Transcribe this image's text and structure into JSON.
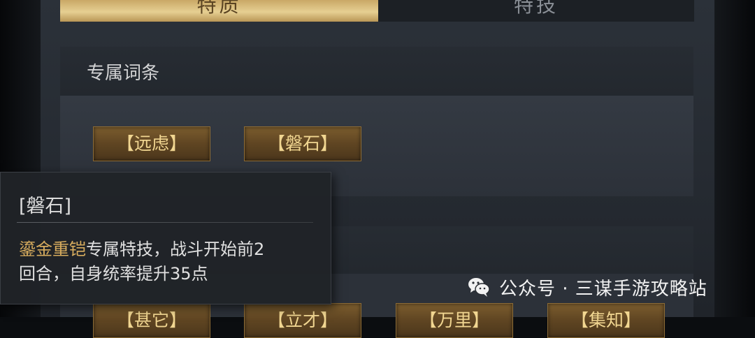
{
  "tabs": [
    {
      "label": "特质",
      "active": true
    },
    {
      "label": "特技",
      "active": false
    }
  ],
  "section_exclusive": {
    "title": "专属词条",
    "tags": [
      "【远虑】",
      "【磐石】"
    ]
  },
  "section_second": {
    "tags": [
      "【甚它】",
      "【立才】",
      "【万里】",
      "【集知】"
    ]
  },
  "tooltip": {
    "title": "[磐石]",
    "equip_name": "鎏金重铠",
    "text_line1": "专属特技，战斗开始前2",
    "text_line2": "回合，自身统率提升35点"
  },
  "watermark": {
    "icon": "wechat-icon",
    "text": "公众号 · 三谋手游攻略站"
  },
  "colors": {
    "gold_tab": "#e6cf92",
    "tag_gold_text": "#f1d691",
    "highlight_gold": "#d7ac5e",
    "panel_bg": "#2b3139"
  }
}
